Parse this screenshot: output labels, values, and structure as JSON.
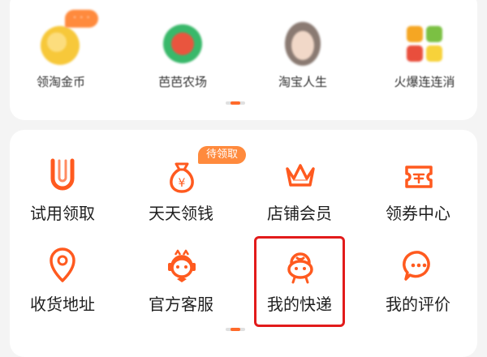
{
  "colors": {
    "accent": "#ff5a1f",
    "highlight": "#e21b1b",
    "badge": "#ff8a3d"
  },
  "top_row": [
    {
      "label": "领淘金币",
      "icon": "gold-coin-icon",
      "badge": "· · ·"
    },
    {
      "label": "芭芭农场",
      "icon": "farm-icon"
    },
    {
      "label": "淘宝人生",
      "icon": "avatar-icon"
    },
    {
      "label": "火爆连连消",
      "icon": "puzzle-game-icon"
    }
  ],
  "services": [
    {
      "label": "试用领取",
      "icon": "trial-u-icon"
    },
    {
      "label": "天天领钱",
      "icon": "money-bag-icon",
      "badge": "待领取"
    },
    {
      "label": "店铺会员",
      "icon": "crown-icon"
    },
    {
      "label": "领券中心",
      "icon": "coupon-icon"
    },
    {
      "label": "收货地址",
      "icon": "location-pin-icon"
    },
    {
      "label": "官方客服",
      "icon": "customer-service-icon"
    },
    {
      "label": "我的快递",
      "icon": "courier-mascot-icon"
    },
    {
      "label": "我的评价",
      "icon": "chat-bubble-icon"
    }
  ]
}
